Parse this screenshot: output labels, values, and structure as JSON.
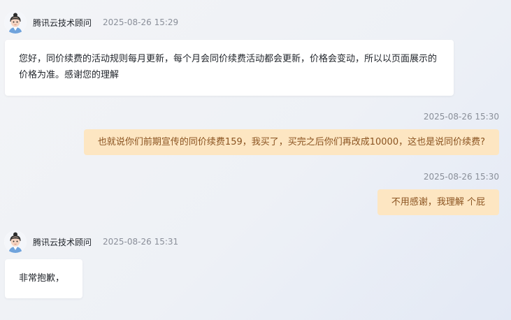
{
  "messages": [
    {
      "sender": "腾讯云技术顾问",
      "time": "2025-08-26 15:29",
      "text": "您好，同价续费的活动规则每月更新，每个月会同价续费活动都会更新，价格会变动，所以以页面展示的价格为准。感谢您的理解"
    },
    {
      "time": "2025-08-26 15:30",
      "text": "也就说你们前期宣传的同价续费159，我买了，买完之后你们再改成10000，这也是说同价续费?"
    },
    {
      "time": "2025-08-26 15:30",
      "text": "不用感谢，我理解 个屁"
    },
    {
      "sender": "腾讯云技术顾问",
      "time": "2025-08-26 15:31",
      "text": "非常抱歉，"
    }
  ],
  "icons": {
    "avatar": "agent-avatar-icon"
  }
}
